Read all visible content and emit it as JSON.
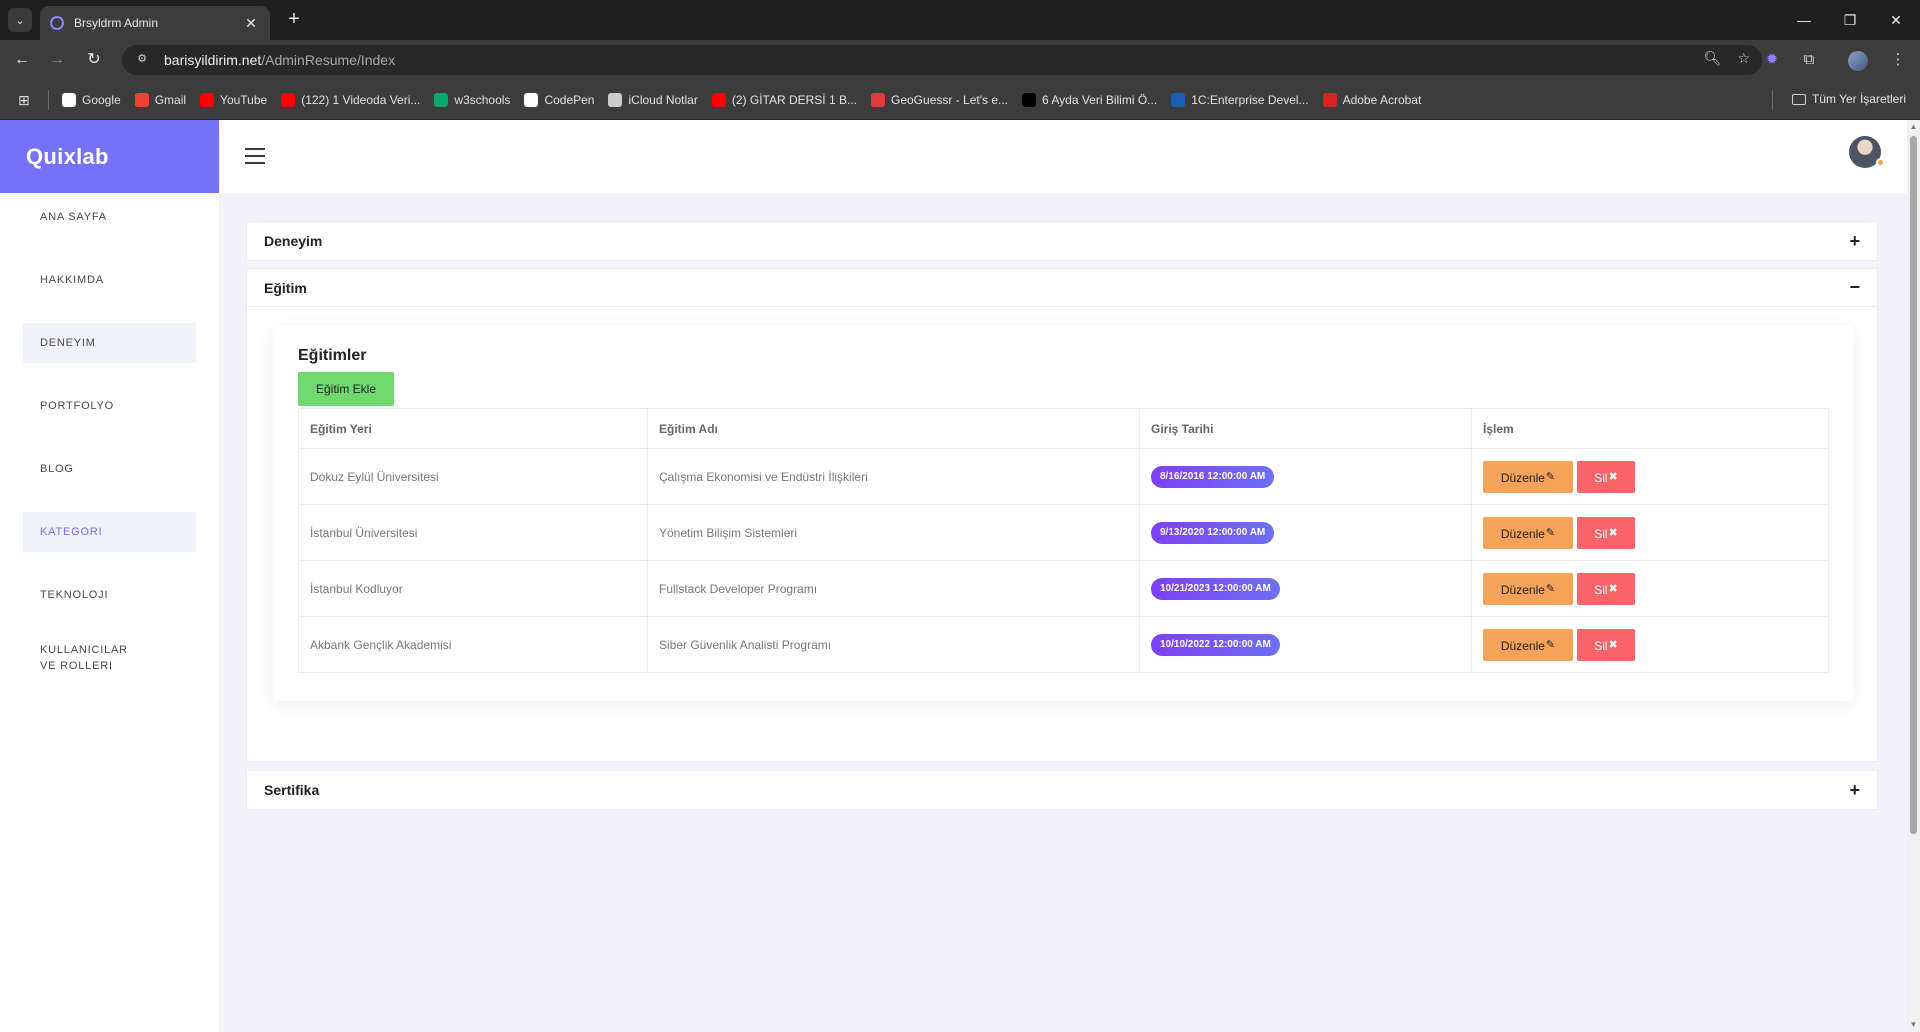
{
  "browser": {
    "tab_title": "Brsyldrm Admin",
    "url_host": "barisyildirim.net",
    "url_path": "/AdminResume/Index",
    "bookmarks": [
      {
        "label": "Google",
        "icon": "google-icon",
        "color": "#ffffff"
      },
      {
        "label": "Gmail",
        "icon": "gmail-icon",
        "color": "#ea4335"
      },
      {
        "label": "YouTube",
        "icon": "youtube-icon",
        "color": "#ff0000"
      },
      {
        "label": "(122) 1 Videoda Veri...",
        "icon": "youtube-icon",
        "color": "#ff0000"
      },
      {
        "label": "w3schools",
        "icon": "w3schools-icon",
        "color": "#04aa6d"
      },
      {
        "label": "CodePen",
        "icon": "codepen-icon",
        "color": "#ffffff"
      },
      {
        "label": "iCloud Notlar",
        "icon": "apple-icon",
        "color": "#cccccc"
      },
      {
        "label": "(2) GİTAR DERSİ 1 B...",
        "icon": "youtube-icon",
        "color": "#ff0000"
      },
      {
        "label": "GeoGuessr - Let's e...",
        "icon": "geoguessr-icon",
        "color": "#e03a3a"
      },
      {
        "label": "6 Ayda Veri Bilimi Ö...",
        "icon": "medium-icon",
        "color": "#000000"
      },
      {
        "label": "1C:Enterprise Devel...",
        "icon": "info-icon",
        "color": "#1a5fb4"
      },
      {
        "label": "Adobe Acrobat",
        "icon": "acrobat-icon",
        "color": "#d92323"
      }
    ],
    "all_bookmarks_label": "Tüm Yer İşaretleri"
  },
  "brand": {
    "name": "Quixlab",
    "color": "#7571f9"
  },
  "sidebar": {
    "items": [
      {
        "label": "ANA SAYFA"
      },
      {
        "label": "HAKKIMDA"
      },
      {
        "label": "DENEYIM"
      },
      {
        "label": "PORTFOLYO"
      },
      {
        "label": "BLOG"
      },
      {
        "label": "KATEGORI"
      },
      {
        "label": "TEKNOLOJI"
      },
      {
        "label": "KULLANICILAR VE ROLLERI"
      }
    ]
  },
  "accordion": {
    "deneyim": {
      "title": "Deneyim",
      "toggle": "+"
    },
    "egitim": {
      "title": "Eğitim",
      "toggle": "−"
    },
    "sertifika": {
      "title": "Sertifika",
      "toggle": "+"
    }
  },
  "education": {
    "card_title": "Eğitimler",
    "add_button": "Eğitim Ekle",
    "columns": [
      "Eğitim Yeri",
      "Eğitim Adı",
      "Giriş Tarihi",
      "İşlem"
    ],
    "edit_label": "Düzenle",
    "delete_label": "Sil",
    "rows": [
      {
        "place": "Dokuz Eylül Üniversitesi",
        "name": "Çalışma Ekonomisi ve Endüstri İlişkileri",
        "date": "8/16/2016 12:00:00 AM"
      },
      {
        "place": "İstanbul Üniversitesi",
        "name": "Yönetim Bilişim Sistemleri",
        "date": "9/13/2020 12:00:00 AM"
      },
      {
        "place": "İstanbul Kodluyor",
        "name": "Fullstack Developer Programı",
        "date": "10/21/2023 12:00:00 AM"
      },
      {
        "place": "Akbank Gençlik Akademisi",
        "name": "Siber Güvenlik Analisti Programı",
        "date": "10/10/2022 12:00:00 AM"
      }
    ]
  },
  "colors": {
    "accent": "#7571f9",
    "add_button": "#6fd96f",
    "edit_button": "#f5a25a",
    "delete_button": "#f76469",
    "date_badge": "#7f3ff5"
  }
}
